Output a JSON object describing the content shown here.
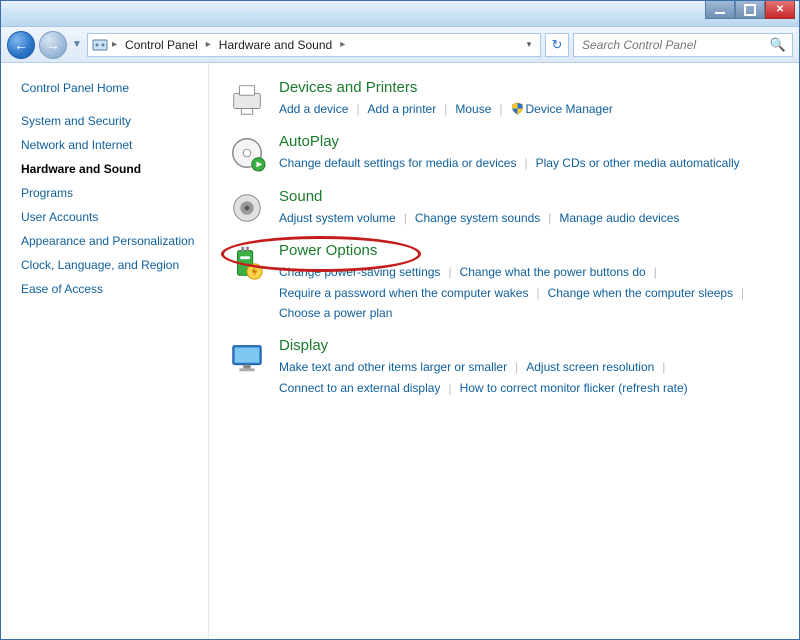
{
  "breadcrumb": {
    "root_label": "Control Panel",
    "current_label": "Hardware and Sound"
  },
  "search": {
    "placeholder": "Search Control Panel"
  },
  "sidebar": {
    "home": "Control Panel Home",
    "items": [
      {
        "label": "System and Security",
        "active": false
      },
      {
        "label": "Network and Internet",
        "active": false
      },
      {
        "label": "Hardware and Sound",
        "active": true
      },
      {
        "label": "Programs",
        "active": false
      },
      {
        "label": "User Accounts",
        "active": false
      },
      {
        "label": "Appearance and Personalization",
        "active": false
      },
      {
        "label": "Clock, Language, and Region",
        "active": false
      },
      {
        "label": "Ease of Access",
        "active": false
      }
    ]
  },
  "categories": [
    {
      "id": "devices-printers",
      "title": "Devices and Printers",
      "links": [
        {
          "label": "Add a device"
        },
        {
          "label": "Add a printer"
        },
        {
          "label": "Mouse"
        },
        {
          "label": "Device Manager",
          "shield": true
        }
      ]
    },
    {
      "id": "autoplay",
      "title": "AutoPlay",
      "links": [
        {
          "label": "Change default settings for media or devices"
        },
        {
          "label": "Play CDs or other media automatically"
        }
      ]
    },
    {
      "id": "sound",
      "title": "Sound",
      "links": [
        {
          "label": "Adjust system volume"
        },
        {
          "label": "Change system sounds"
        },
        {
          "label": "Manage audio devices"
        }
      ]
    },
    {
      "id": "power-options",
      "title": "Power Options",
      "links": [
        {
          "label": "Change power-saving settings"
        },
        {
          "label": "Change what the power buttons do"
        },
        {
          "label": "Require a password when the computer wakes"
        },
        {
          "label": "Change when the computer sleeps"
        },
        {
          "label": "Choose a power plan"
        }
      ]
    },
    {
      "id": "display",
      "title": "Display",
      "links": [
        {
          "label": "Make text and other items larger or smaller"
        },
        {
          "label": "Adjust screen resolution"
        },
        {
          "label": "Connect to an external display"
        },
        {
          "label": "How to correct monitor flicker (refresh rate)"
        }
      ]
    }
  ],
  "annotation": {
    "target": "power-options"
  }
}
